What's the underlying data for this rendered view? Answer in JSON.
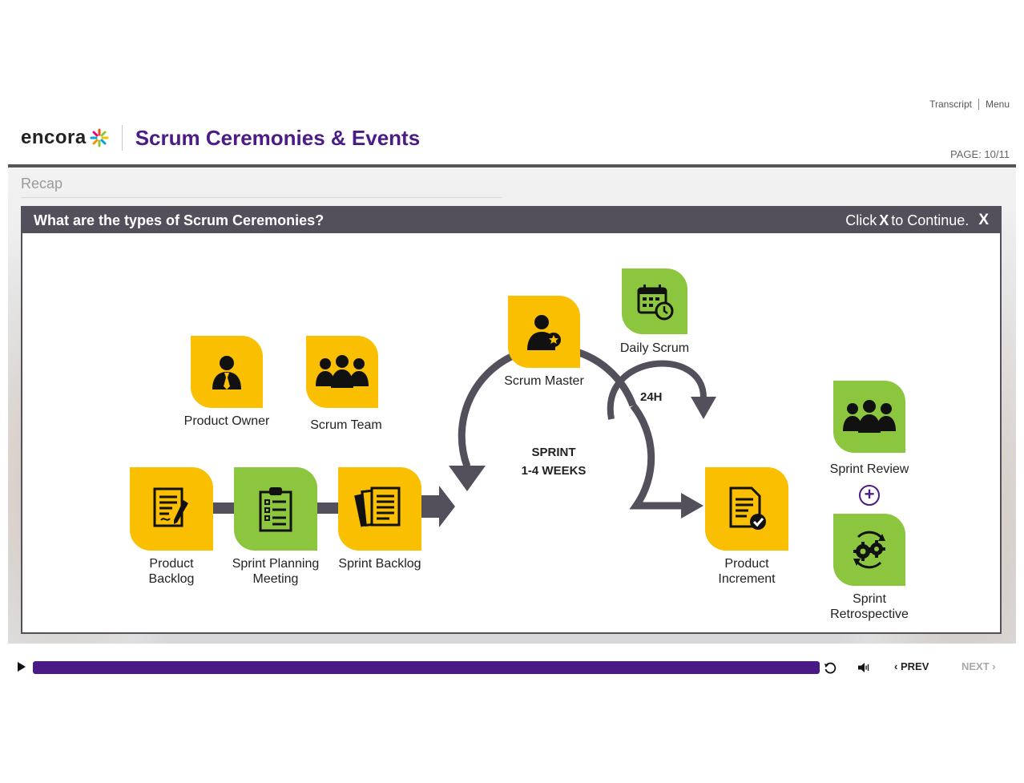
{
  "header": {
    "links": {
      "transcript": "Transcript",
      "menu": "Menu"
    },
    "logo_text": "encora",
    "course_title": "Scrum Ceremonies & Events",
    "page_indicator": "PAGE: 10/11"
  },
  "slide": {
    "section_title": "Recap",
    "modal": {
      "title": "What are the types of Scrum Ceremonies?",
      "hint_prefix": "Click",
      "hint_key": "X",
      "hint_suffix": "to Continue.",
      "close_label": "X"
    },
    "diagram": {
      "product_owner": "Product Owner",
      "scrum_team": "Scrum Team",
      "scrum_master": "Scrum Master",
      "daily_scrum": "Daily Scrum",
      "daily_cycle": "24H",
      "sprint_line1": "SPRINT",
      "sprint_line2": "1-4 WEEKS",
      "product_backlog": "Product Backlog",
      "sprint_planning": "Sprint Planning Meeting",
      "sprint_backlog": "Sprint Backlog",
      "product_increment": "Product Increment",
      "sprint_review": "Sprint Review",
      "plus_symbol": "+",
      "sprint_retrospective": "Sprint Retrospective"
    }
  },
  "player": {
    "progress": 1.0,
    "prev_label": "PREV",
    "next_label": "NEXT"
  },
  "colors": {
    "brand_purple": "#4b1b86",
    "tile_yellow": "#f9bf00",
    "tile_green": "#8cc63f",
    "modal_header": "#53505c"
  }
}
